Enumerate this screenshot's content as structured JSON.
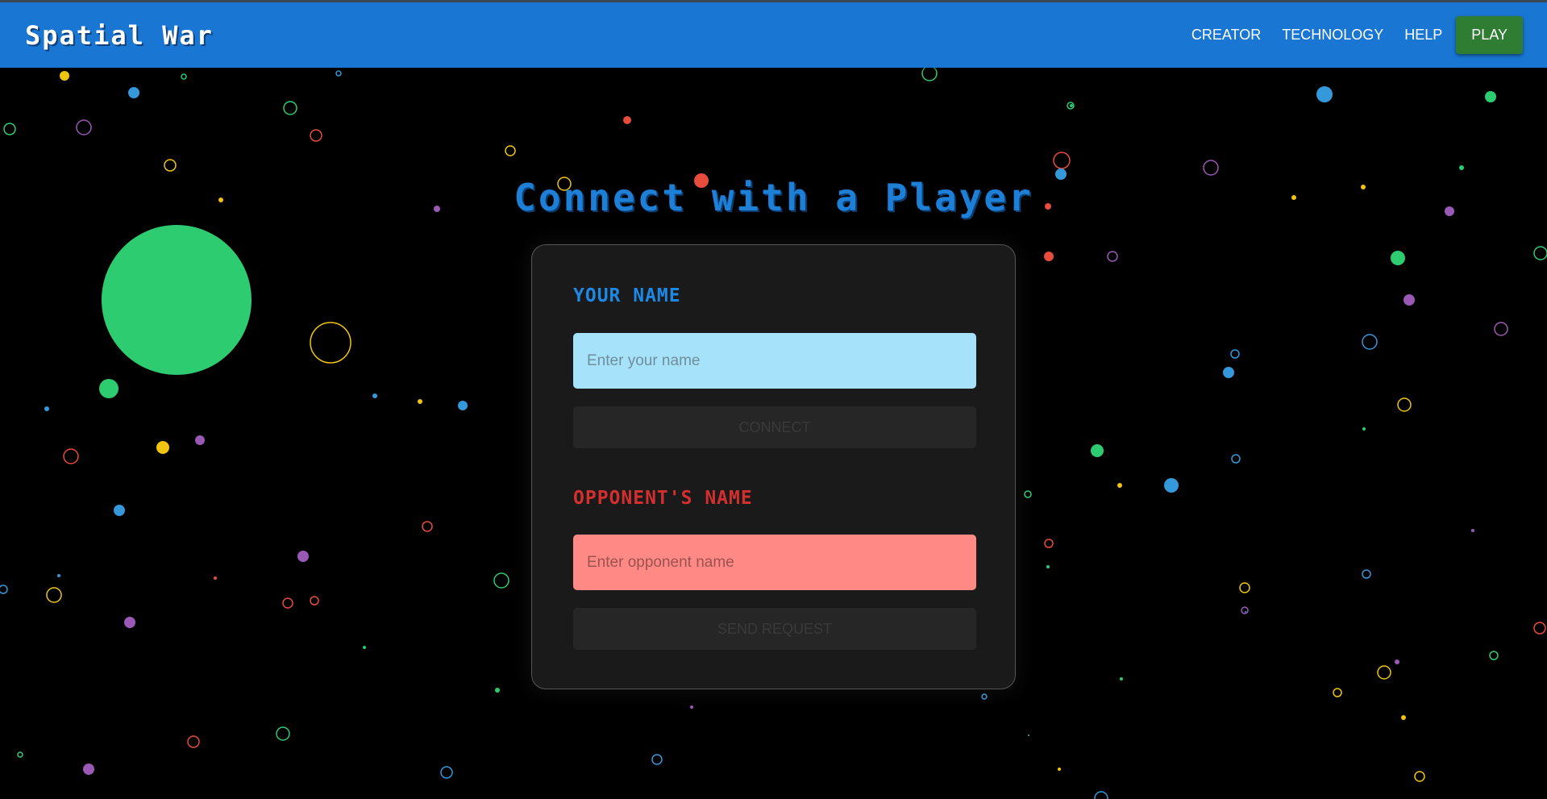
{
  "app": {
    "title": "Spatial War"
  },
  "nav": {
    "links": [
      {
        "label": "CREATOR"
      },
      {
        "label": "TECHNOLOGY"
      },
      {
        "label": "HELP"
      }
    ],
    "play_label": "PLAY"
  },
  "main": {
    "title": "Connect with a Player",
    "your_name": {
      "label": "YOUR NAME",
      "placeholder": "Enter your name",
      "value": "",
      "button_label": "CONNECT"
    },
    "opponent": {
      "label": "OPPONENT'S NAME",
      "placeholder": "Enter opponent name",
      "value": "",
      "button_label": "SEND REQUEST"
    }
  },
  "colors": {
    "navbar": "#1976d2",
    "play_button": "#2e7d32",
    "title": "#1e7fd6",
    "your_label": "#1e88e5",
    "opponent_label": "#d32f2f",
    "your_input_bg": "#a6e3fb",
    "opponent_input_bg": "#ff8a85",
    "background": "#000000",
    "particles": [
      "#2ecc71",
      "#3498db",
      "#f1c40f",
      "#e74c3c",
      "#9b59b6"
    ]
  },
  "icons": [
    "background-particles"
  ]
}
